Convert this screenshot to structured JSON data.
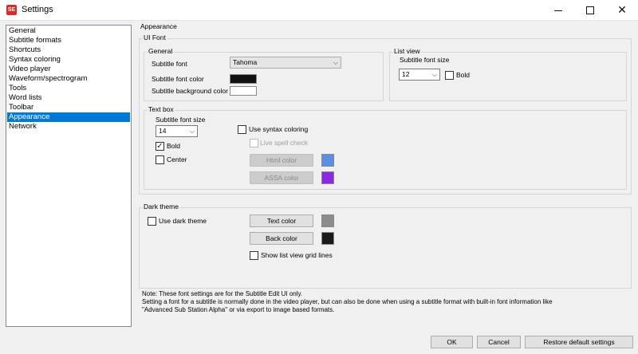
{
  "window": {
    "title": "Settings",
    "app_icon_text": "SE",
    "controls": {
      "close_glyph": "✕"
    }
  },
  "nav": {
    "items": [
      "General",
      "Subtitle formats",
      "Shortcuts",
      "Syntax coloring",
      "Video player",
      "Waveform/spectrogram",
      "Tools",
      "Word lists",
      "Toolbar",
      "Appearance",
      "Network"
    ],
    "selected": "Appearance"
  },
  "appearance": {
    "section_title": "Appearance",
    "ui_font": {
      "title": "UI Font",
      "general": {
        "title": "General",
        "subtitle_font_label": "Subtitle font",
        "subtitle_font_value": "Tahoma",
        "subtitle_font_color_label": "Subtitle font color",
        "subtitle_bg_color_label": "Subtitle background color"
      },
      "list_view": {
        "title": "List view",
        "font_size_label": "Subtitle font size",
        "font_size_value": "12",
        "bold_label": "Bold",
        "bold_checked": false
      },
      "text_box": {
        "title": "Text box",
        "font_size_label": "Subtitle font size",
        "font_size_value": "14",
        "bold_label": "Bold",
        "bold_checked": true,
        "center_label": "Center",
        "center_checked": false,
        "use_syntax_coloring_label": "Use syntax coloring",
        "use_syntax_coloring_checked": false,
        "live_spell_check_label": "Live spell check",
        "html_color_label": "Html color",
        "assa_color_label": "ASSA color"
      }
    },
    "dark_theme": {
      "title": "Dark theme",
      "use_dark_theme_label": "Use dark theme",
      "use_dark_theme_checked": false,
      "text_color_label": "Text color",
      "back_color_label": "Back color",
      "show_grid_lines_label": "Show list view grid lines",
      "show_grid_lines_checked": false
    },
    "note_lines": [
      "Note: These font settings are for the Subtitle Edit UI only.",
      "Setting a font for a subtitle is normally done in the video player, but can also be done when using a subtitle format with built-in font information like",
      "\"Advanced Sub Station Alpha\" or via export to image based formats."
    ]
  },
  "buttons": {
    "ok": "OK",
    "cancel": "Cancel",
    "restore": "Restore default settings"
  },
  "colors": {
    "subtitle_font_color": "#111111",
    "subtitle_background_color": "#ffffff",
    "html_color": "#5b8fe0",
    "assa_color": "#8a2be2",
    "dark_text_color": "#8c8c8c",
    "dark_back_color": "#1a1a1a",
    "selection": "#0078d7"
  },
  "icons": {
    "combo_arrow": "chevron-down-icon",
    "check": "check-icon"
  }
}
